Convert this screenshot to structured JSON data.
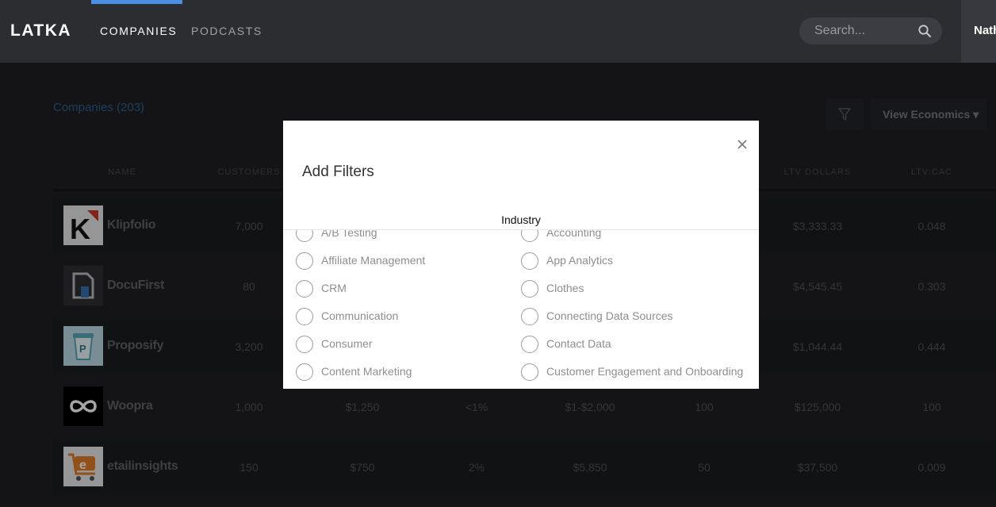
{
  "header": {
    "logo": "LATKA",
    "nav": [
      {
        "label": "COMPANIES",
        "active": true
      },
      {
        "label": "PODCASTS",
        "active": false
      }
    ],
    "search_placeholder": "Search...",
    "user_name": "Nathan"
  },
  "page": {
    "title": "Companies (203)",
    "view_button_label": "View Economics ▾",
    "columns": [
      "NAME",
      "CUSTOMERS",
      "LTV DOLLARS",
      "LTV:CAC"
    ],
    "rows": [
      {
        "name": "Klipfolio",
        "customers": "7,000",
        "ltv_dollars": "$3,333.33",
        "ltv_cac": "0.048"
      },
      {
        "name": "DocuFirst",
        "customers": "80",
        "ltv_dollars": "$4,545.45",
        "ltv_cac": "0.303"
      },
      {
        "name": "Proposify",
        "customers": "3,200",
        "ltv_dollars": "$1,044.44",
        "ltv_cac": "0.444"
      },
      {
        "name": "Woopra",
        "customers": "1,000",
        "c3": "$1,250",
        "c4": "<1%",
        "c5": "$1-$2,000",
        "c6": "100",
        "ltv_dollars": "$125,000",
        "ltv_cac": "100"
      },
      {
        "name": "etailinsights",
        "customers": "150",
        "c3": "$750",
        "c4": "2%",
        "c5": "$5,850",
        "c6": "50",
        "ltv_dollars": "$37,500",
        "ltv_cac": "0.009"
      }
    ]
  },
  "modal": {
    "title": "Add Filters",
    "section_label": "Industry",
    "options": [
      "A/B Testing",
      "Accounting",
      "Affiliate Management",
      "App Analytics",
      "CRM",
      "Clothes",
      "Communication",
      "Connecting Data Sources",
      "Consumer",
      "Contact Data",
      "Content Marketing",
      "Customer Engagement and Onboarding"
    ]
  },
  "colors": {
    "accent": "#4a90e2",
    "header_bg": "#2c2d31",
    "page_bg": "#1f2024",
    "modal_bg": "#ffffff"
  }
}
